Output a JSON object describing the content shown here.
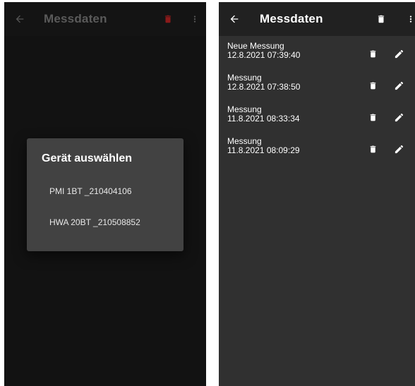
{
  "colors": {
    "left_background": "#121212",
    "right_background": "#303030",
    "appbar_dark": "#212121",
    "dialog_background": "#424242",
    "delete_accent": "#8b1a1a",
    "text_primary": "#ffffff"
  },
  "left_screen": {
    "appbar": {
      "title": "Messdaten",
      "back_icon": "arrow-left-icon",
      "delete_icon": "trash-icon",
      "menu_icon": "more-vert-icon"
    },
    "dialog": {
      "title": "Gerät auswählen",
      "options": [
        {
          "label": "PMI 1BT _210404106"
        },
        {
          "label": "HWA 20BT _210508852"
        }
      ]
    }
  },
  "right_screen": {
    "appbar": {
      "title": "Messdaten",
      "back_icon": "arrow-left-icon",
      "delete_icon": "trash-icon",
      "menu_icon": "more-vert-icon"
    },
    "measurements": [
      {
        "name": "Neue Messung",
        "date": "12.8.2021 07:39:40"
      },
      {
        "name": "Messung",
        "date": "12.8.2021 07:38:50"
      },
      {
        "name": "Messung",
        "date": "11.8.2021 08:33:34"
      },
      {
        "name": "Messung",
        "date": "11.8.2021 08:09:29"
      }
    ]
  }
}
